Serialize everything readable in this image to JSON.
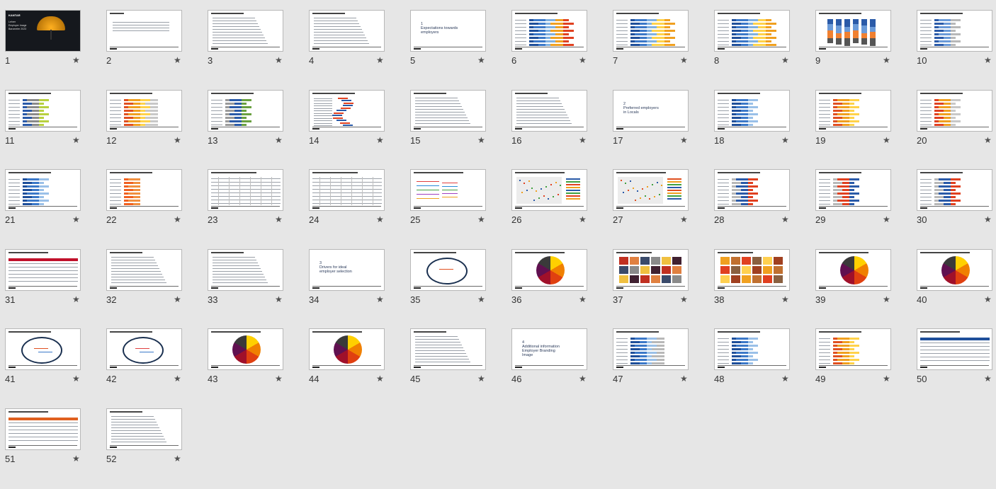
{
  "slides": [
    {
      "n": "1",
      "kind": "cover",
      "cover": {
        "brand": "KANTAR",
        "lines": [
          "Lehrer",
          "Employer Image",
          "Barometer 2023"
        ]
      }
    },
    {
      "n": "2",
      "kind": "toc"
    },
    {
      "n": "3",
      "kind": "text"
    },
    {
      "n": "4",
      "kind": "text"
    },
    {
      "n": "5",
      "kind": "section",
      "section": {
        "num": "1",
        "lines": [
          "Expectations towards",
          "employers"
        ]
      }
    },
    {
      "n": "6",
      "kind": "hbars",
      "colors": [
        "#1f4f9a",
        "#3b78c8",
        "#7fb0e0",
        "#f0a020",
        "#e04020"
      ]
    },
    {
      "n": "7",
      "kind": "hbars",
      "colors": [
        "#1f4f9a",
        "#3b78c8",
        "#7fb0e0",
        "#ffd24a",
        "#f0a020"
      ]
    },
    {
      "n": "8",
      "kind": "hbars",
      "colors": [
        "#1f4f9a",
        "#3b78c8",
        "#7fb0e0",
        "#ffd24a",
        "#f0a020"
      ]
    },
    {
      "n": "9",
      "kind": "cols",
      "colors": [
        "#2a5aa8",
        "#6a9ad8",
        "#f08030",
        "#555555"
      ]
    },
    {
      "n": "10",
      "kind": "hbars",
      "colors": [
        "#2a5aa8",
        "#6a9ad8",
        "#b8b8b8"
      ]
    },
    {
      "n": "11",
      "kind": "hbars",
      "colors": [
        "#2a5aa8",
        "#8a8a8a",
        "#b8d040"
      ]
    },
    {
      "n": "12",
      "kind": "hbars",
      "colors": [
        "#e05020",
        "#f0a020",
        "#ffd24a",
        "#c8c8c8"
      ]
    },
    {
      "n": "13",
      "kind": "hbars",
      "colors": [
        "#9a9a9a",
        "#2a5aa8",
        "#6aa040"
      ]
    },
    {
      "n": "14",
      "kind": "wave",
      "colors": [
        "#e04020",
        "#2a5aa8"
      ]
    },
    {
      "n": "15",
      "kind": "text"
    },
    {
      "n": "16",
      "kind": "text"
    },
    {
      "n": "17",
      "kind": "section",
      "section": {
        "num": "2",
        "lines": [
          "Preferred employers",
          "in Locals"
        ]
      }
    },
    {
      "n": "18",
      "kind": "hbars",
      "colors": [
        "#1f4f9a",
        "#3b78c8",
        "#9ac0e8"
      ]
    },
    {
      "n": "19",
      "kind": "hbars",
      "colors": [
        "#e05020",
        "#f0a020",
        "#ffd24a"
      ]
    },
    {
      "n": "20",
      "kind": "hbars",
      "colors": [
        "#e04020",
        "#f0a020",
        "#c8c8c8"
      ]
    },
    {
      "n": "21",
      "kind": "hbars",
      "colors": [
        "#1f4f9a",
        "#3b78c8",
        "#9ac0e8"
      ]
    },
    {
      "n": "22",
      "kind": "hbars",
      "colors": [
        "#f06020",
        "#f09040"
      ]
    },
    {
      "n": "23",
      "kind": "table"
    },
    {
      "n": "24",
      "kind": "table"
    },
    {
      "n": "25",
      "kind": "lines",
      "colors": [
        "#e04040",
        "#2a8ad8",
        "#40a040",
        "#a040c0",
        "#f0a020"
      ]
    },
    {
      "n": "26",
      "kind": "scatter",
      "colors": [
        "#2a5aa8",
        "#40a040",
        "#e04020",
        "#f0a020"
      ]
    },
    {
      "n": "27",
      "kind": "scatter",
      "colors": [
        "#e05020",
        "#f0a020",
        "#40a040",
        "#2a5aa8"
      ]
    },
    {
      "n": "28",
      "kind": "hbars",
      "colors": [
        "#b8b8b8",
        "#2a5aa8",
        "#e04020"
      ]
    },
    {
      "n": "29",
      "kind": "hbars",
      "colors": [
        "#b8b8b8",
        "#e04020",
        "#2a5aa8"
      ]
    },
    {
      "n": "30",
      "kind": "hbars",
      "colors": [
        "#b8b8b8",
        "#2a5aa8",
        "#e04020"
      ]
    },
    {
      "n": "31",
      "kind": "redtable",
      "colors": [
        "#c0102a"
      ]
    },
    {
      "n": "32",
      "kind": "text"
    },
    {
      "n": "33",
      "kind": "text"
    },
    {
      "n": "34",
      "kind": "section",
      "section": {
        "num": "3",
        "lines": [
          "Drivers for ideal",
          "employer selection"
        ]
      }
    },
    {
      "n": "35",
      "kind": "ring",
      "colors": [
        "#1a3050",
        "#e05020"
      ]
    },
    {
      "n": "36",
      "kind": "pie",
      "colors": [
        "#ffd000",
        "#f08000",
        "#e04010",
        "#a0102a",
        "#601050",
        "#3a3a3a"
      ]
    },
    {
      "n": "37",
      "kind": "photos",
      "colors": [
        "#c03020",
        "#e08040",
        "#3a4a6a",
        "#8a8a8a",
        "#f0c040",
        "#402030"
      ]
    },
    {
      "n": "38",
      "kind": "photos",
      "colors": [
        "#f0a020",
        "#c07030",
        "#e04020",
        "#8a6040",
        "#ffd050",
        "#a04020"
      ]
    },
    {
      "n": "39",
      "kind": "pie",
      "colors": [
        "#ffd000",
        "#f08000",
        "#e04010",
        "#a0102a",
        "#601050",
        "#3a3a3a"
      ]
    },
    {
      "n": "40",
      "kind": "pie",
      "colors": [
        "#ffd000",
        "#f08000",
        "#e04010",
        "#a0102a",
        "#601050",
        "#3a3a3a"
      ]
    },
    {
      "n": "41",
      "kind": "ring",
      "colors": [
        "#1a3050",
        "#e05020",
        "#3a78c8"
      ]
    },
    {
      "n": "42",
      "kind": "ring",
      "colors": [
        "#1a3050",
        "#e04040",
        "#3a78c8"
      ]
    },
    {
      "n": "43",
      "kind": "pie",
      "colors": [
        "#ffd000",
        "#f08000",
        "#e04010",
        "#a0102a",
        "#601050",
        "#3a3a3a"
      ]
    },
    {
      "n": "44",
      "kind": "pie",
      "colors": [
        "#ffd000",
        "#f08000",
        "#e04010",
        "#a0102a",
        "#601050",
        "#3a3a3a"
      ]
    },
    {
      "n": "45",
      "kind": "text"
    },
    {
      "n": "46",
      "kind": "section",
      "section": {
        "num": "4",
        "lines": [
          "Additional information",
          "Employer Branding",
          "Image"
        ]
      }
    },
    {
      "n": "47",
      "kind": "hbars",
      "colors": [
        "#1f4f9a",
        "#3b78c8",
        "#9ac0e8",
        "#b8b8b8"
      ]
    },
    {
      "n": "48",
      "kind": "hbars",
      "colors": [
        "#1f4f9a",
        "#3b78c8",
        "#9ac0e8"
      ]
    },
    {
      "n": "49",
      "kind": "hbars",
      "colors": [
        "#e05020",
        "#f0a020",
        "#ffd24a"
      ]
    },
    {
      "n": "50",
      "kind": "bluetable",
      "colors": [
        "#1f4f9a"
      ]
    },
    {
      "n": "51",
      "kind": "orangetable",
      "colors": [
        "#e06020"
      ]
    },
    {
      "n": "52",
      "kind": "text"
    }
  ],
  "star": "★",
  "columns": 10
}
